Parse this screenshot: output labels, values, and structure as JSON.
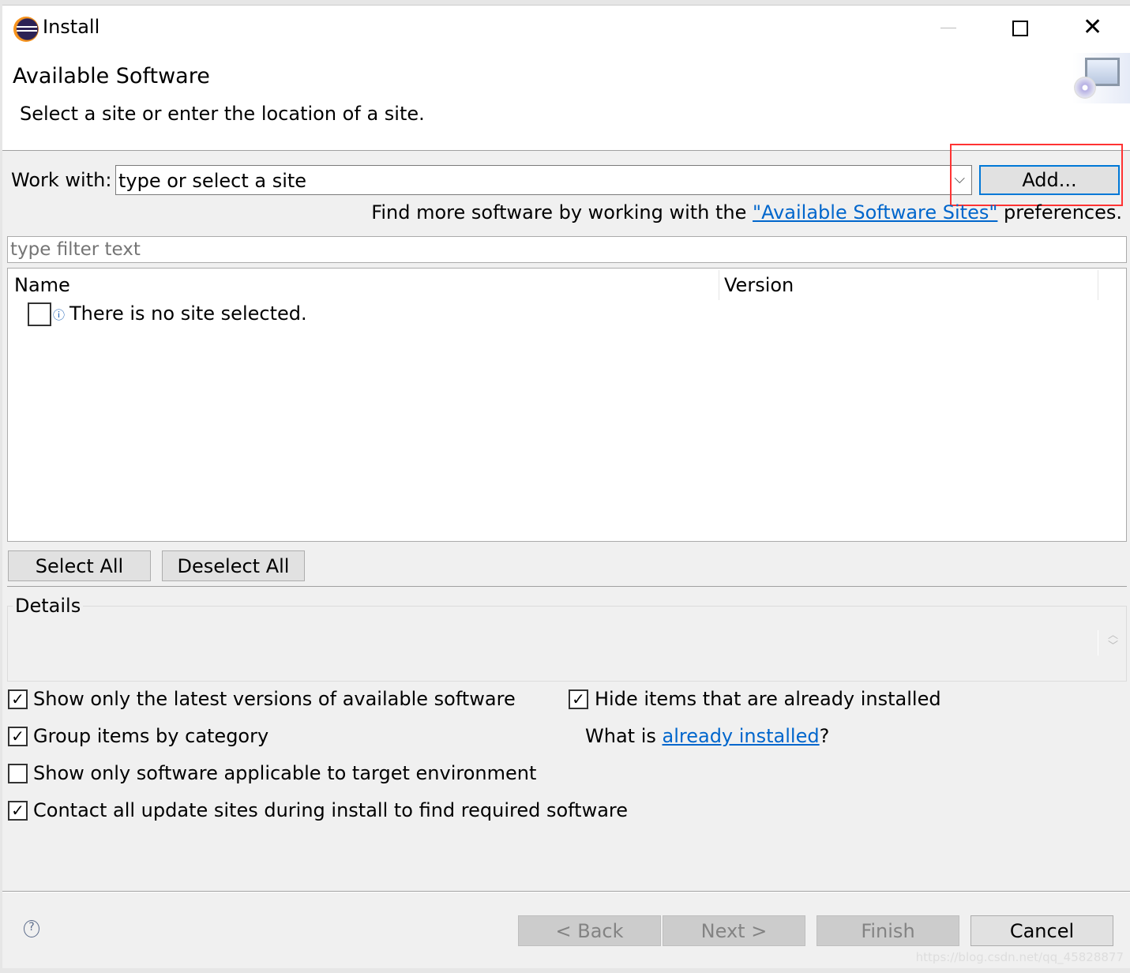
{
  "window": {
    "title": "Install"
  },
  "header": {
    "title": "Available Software",
    "subtitle": "Select a site or enter the location of a site."
  },
  "work_with": {
    "label": "Work with:",
    "value": "type or select a site",
    "add_label": "Add..."
  },
  "find_more": {
    "prefix": "Find more software by working with the ",
    "link": "\"Available Software Sites\"",
    "suffix": " preferences."
  },
  "filter": {
    "placeholder": "type filter text"
  },
  "table": {
    "columns": [
      "Name",
      "Version"
    ],
    "rows": [
      {
        "name": "There is no site selected.",
        "checked": false
      }
    ]
  },
  "buttons": {
    "select_all": "Select All",
    "deselect_all": "Deselect All",
    "back": "< Back",
    "next": "Next >",
    "finish": "Finish",
    "cancel": "Cancel"
  },
  "details": {
    "label": "Details"
  },
  "options": [
    {
      "label": "Show only the latest versions of available software",
      "checked": true
    },
    {
      "label": "Hide items that are already installed",
      "checked": true
    },
    {
      "label": "Group items by category",
      "checked": true
    },
    {
      "label": "Show only software applicable to target environment",
      "checked": false
    },
    {
      "label": "Contact all update sites during install to find required software",
      "checked": true
    }
  ],
  "installed": {
    "prefix": "What is ",
    "link": "already installed",
    "suffix": "?"
  },
  "watermark": "https://blog.csdn.net/qq_45828877",
  "colors": {
    "link": "#0066cc",
    "highlight": "#ff3333",
    "focus": "#0078d7"
  }
}
